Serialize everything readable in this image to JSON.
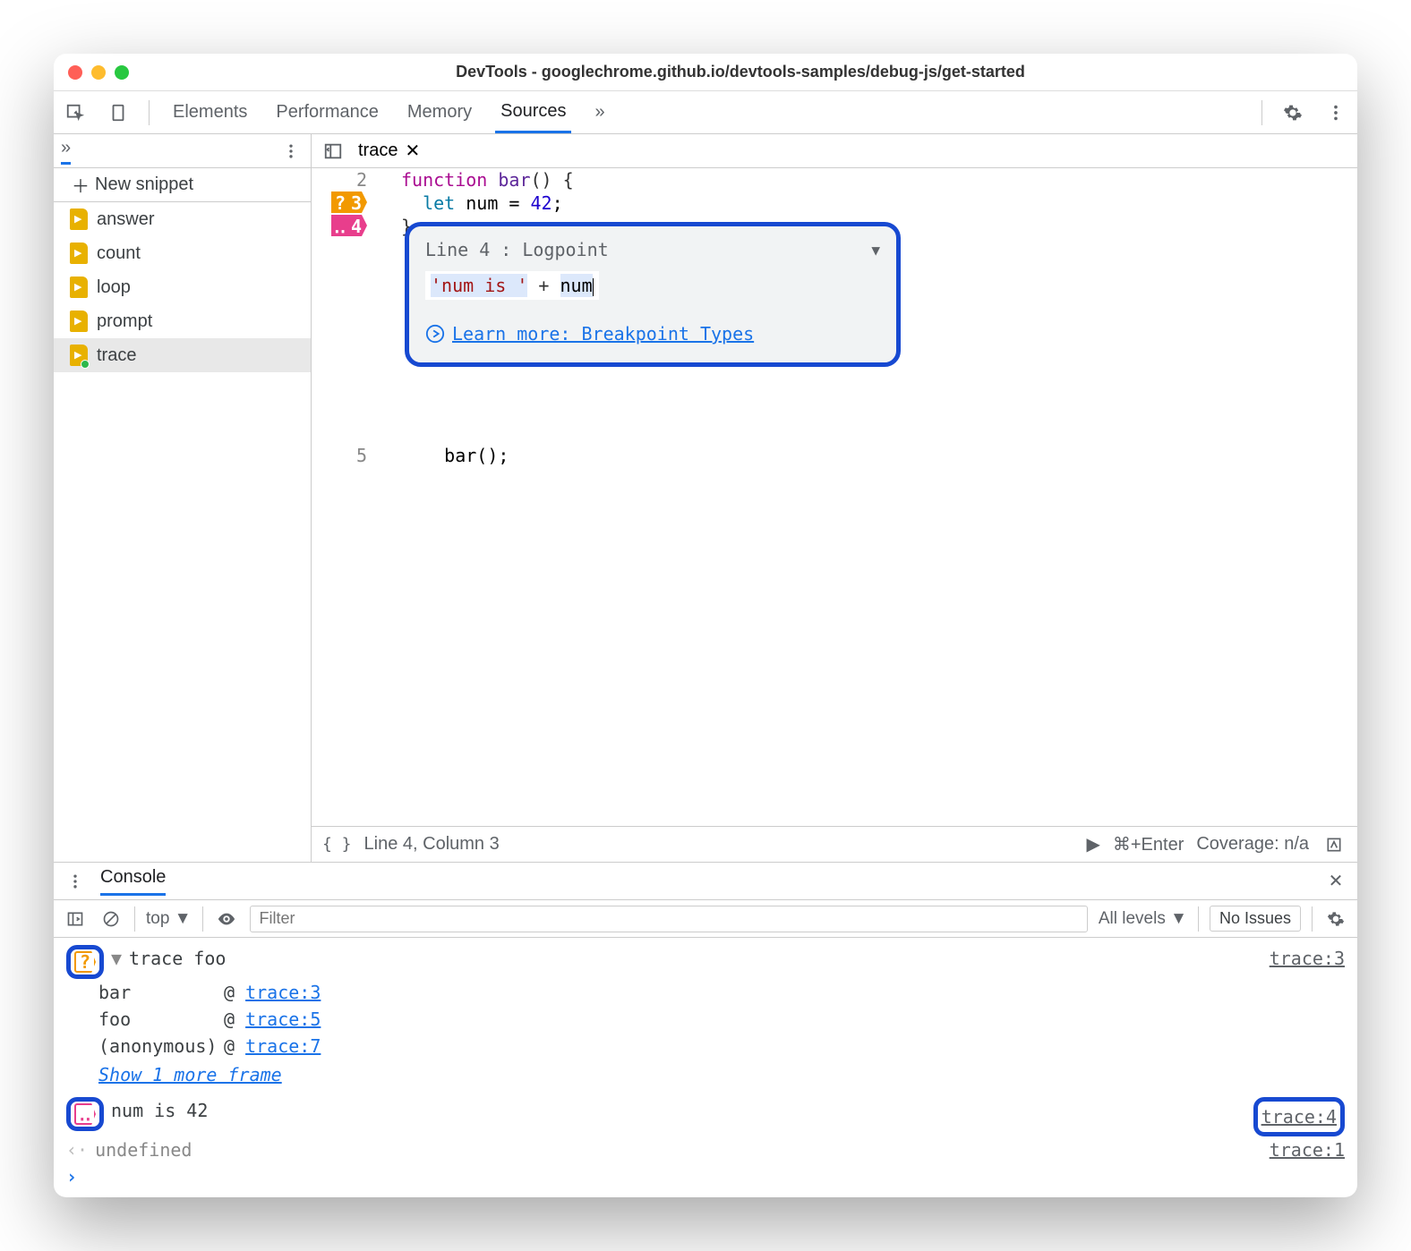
{
  "window": {
    "title": "DevTools - googlechrome.github.io/devtools-samples/debug-js/get-started"
  },
  "toolbar": {
    "tabs": [
      "Elements",
      "Performance",
      "Memory",
      "Sources"
    ],
    "activeTab": "Sources",
    "more": "»"
  },
  "sidebar": {
    "chevLabel": "»",
    "newSnippet": "New snippet",
    "snippets": [
      "answer",
      "count",
      "loop",
      "prompt",
      "trace"
    ],
    "selected": "trace"
  },
  "editor": {
    "filename": "trace",
    "lines": {
      "2": {
        "num": "2"
      },
      "3": {
        "num": "3"
      },
      "4": {
        "num": "4"
      },
      "5": {
        "num": "5",
        "text": "bar();"
      }
    },
    "code": {
      "fnKw": "function",
      "fnName": "bar",
      "parens": "() {",
      "letKw": "let",
      "varName": " num = ",
      "val": "42",
      "semi": ";",
      "close": "}",
      "call": "    bar();"
    }
  },
  "popover": {
    "lineLabel": "Line 4 :",
    "typeLabel": "Logpoint",
    "inputStr": "'num is '",
    "inputPlus": " + ",
    "inputVar": "num",
    "learn": "Learn more: Breakpoint Types"
  },
  "statusbar": {
    "pos": "Line 4, Column 3",
    "shortcut": "⌘+Enter",
    "coverage": "Coverage: n/a"
  },
  "drawer": {
    "tab": "Console",
    "context": "top",
    "filterPlaceholder": "Filter",
    "levels": "All levels",
    "issues": "No Issues"
  },
  "console": {
    "entries": [
      {
        "icon": "orange",
        "text": "trace foo",
        "src": "trace:3",
        "expand": true
      },
      {
        "plain": "num is 42",
        "icon": "pink",
        "src": "trace:4",
        "hlSrc": true
      },
      {
        "ret": "undefined",
        "src": "trace:1"
      }
    ],
    "stack": [
      {
        "fn": "bar",
        "at": "@",
        "link": "trace:3"
      },
      {
        "fn": "foo",
        "at": "@",
        "link": "trace:5"
      },
      {
        "fn": "(anonymous)",
        "at": "@",
        "link": "trace:7"
      }
    ],
    "showMore": "Show 1 more frame"
  }
}
